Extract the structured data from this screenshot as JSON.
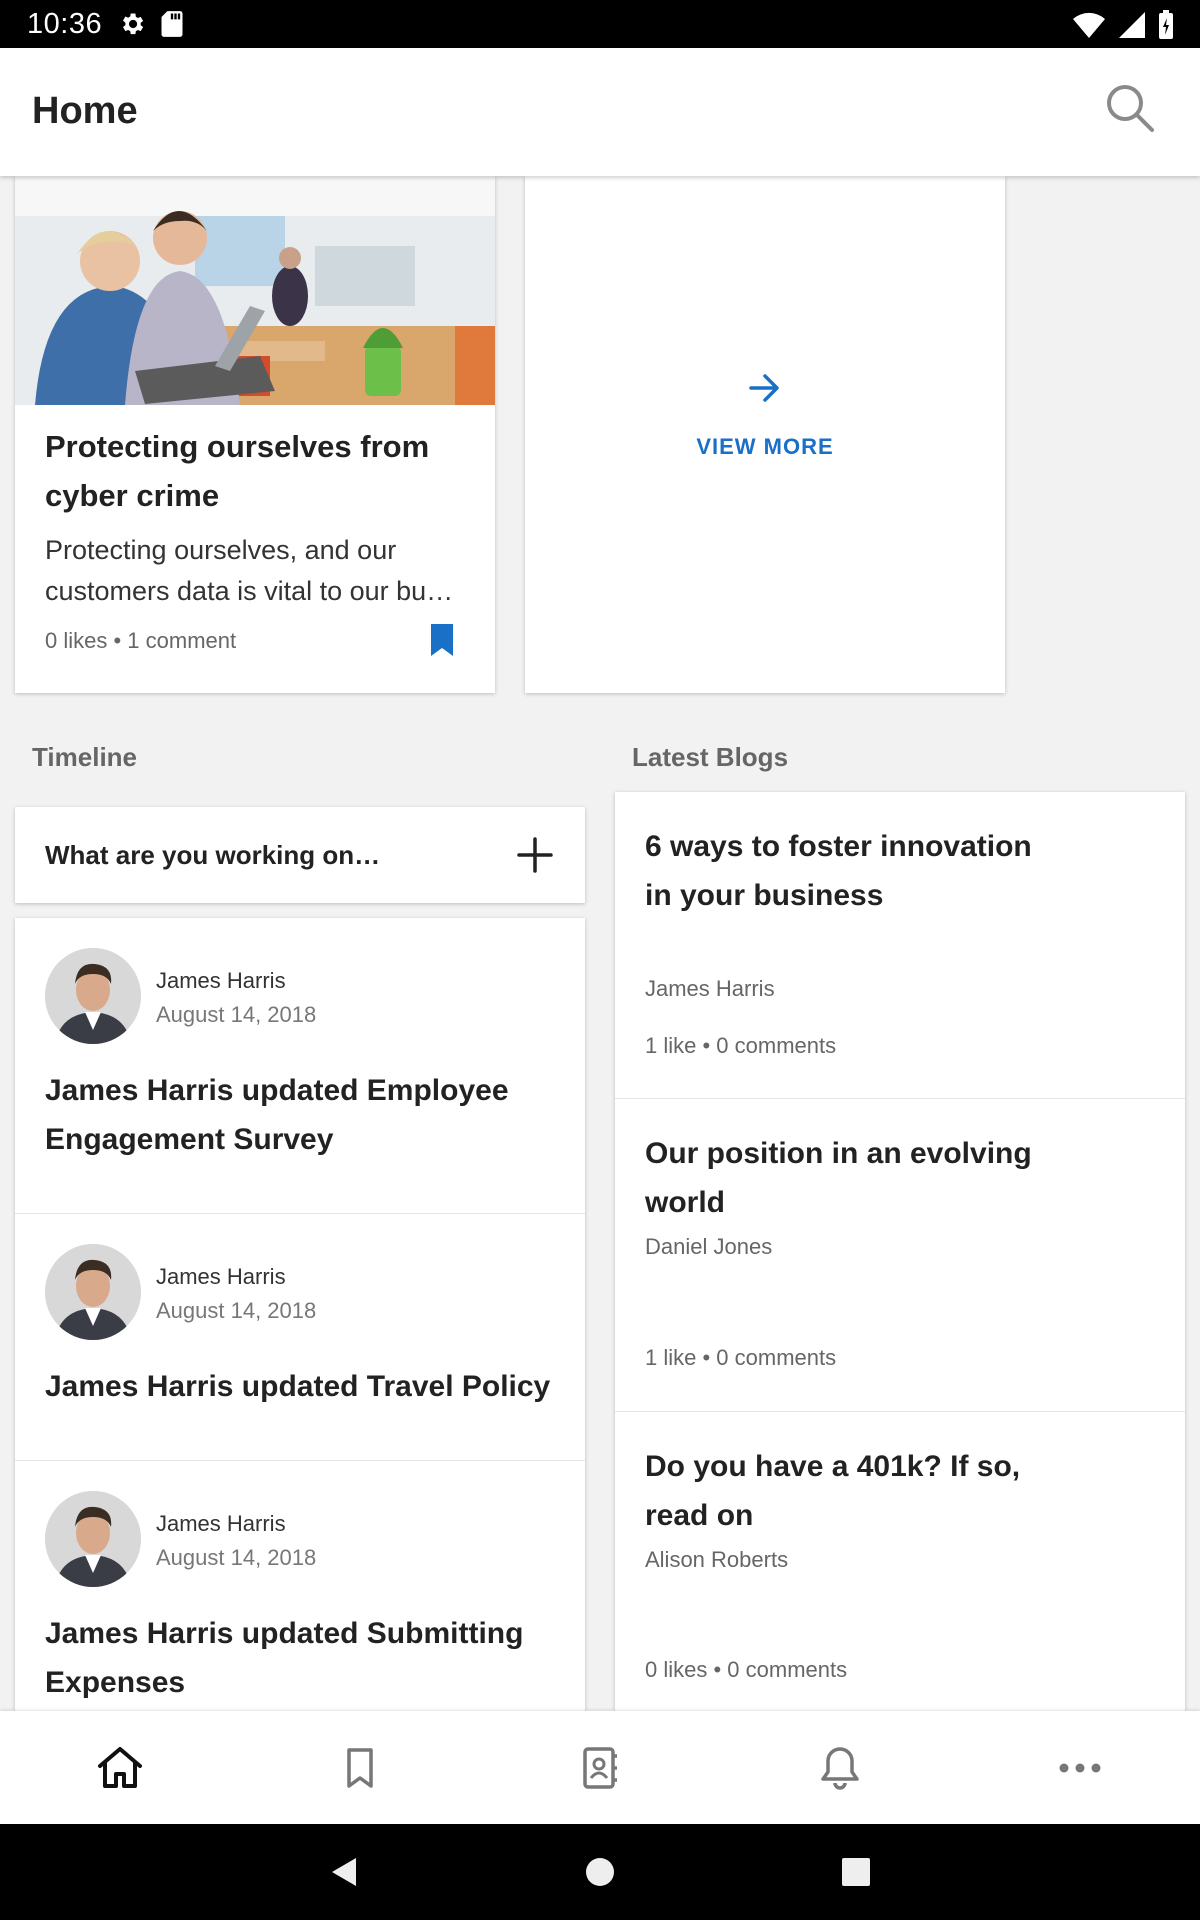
{
  "status_bar": {
    "time": "10:36"
  },
  "app_bar": {
    "title": "Home"
  },
  "featured_article": {
    "title": "Protecting ourselves from cyber crime",
    "description": "Protecting ourselves, and our customers data is vital to our bu…",
    "meta": "0 likes • 1 comment"
  },
  "view_more": {
    "label": "VIEW MORE"
  },
  "timeline": {
    "section_title": "Timeline",
    "compose_placeholder": "What are you working on…",
    "items": [
      {
        "author": "James Harris",
        "date": "August 14, 2018",
        "text": "James Harris updated Employee Engagement Survey"
      },
      {
        "author": "James Harris",
        "date": "August 14, 2018",
        "text": "James Harris updated Travel Policy"
      },
      {
        "author": "James Harris",
        "date": "August 14, 2018",
        "text": "James Harris updated Submitting Expenses"
      }
    ]
  },
  "blogs": {
    "section_title": "Latest Blogs",
    "items": [
      {
        "title": "6 ways to foster innovation in your business",
        "author": "James Harris",
        "meta": "1 like • 0 comments"
      },
      {
        "title": "Our position in an evolving world",
        "author": "Daniel Jones",
        "meta": "1 like • 0 comments"
      },
      {
        "title": "Do you have a 401k? If so, read on",
        "author": "Alison Roberts",
        "meta": "0 likes • 0 comments"
      }
    ]
  },
  "bottom_nav": {
    "items": [
      {
        "icon": "home-icon",
        "active": true
      },
      {
        "icon": "bookmark-icon",
        "active": false
      },
      {
        "icon": "directory-icon",
        "active": false
      },
      {
        "icon": "bell-icon",
        "active": false
      },
      {
        "icon": "more-icon",
        "active": false
      }
    ]
  },
  "colors": {
    "accent": "#1a6fc7",
    "text_primary": "#222222",
    "text_secondary": "#666666"
  }
}
